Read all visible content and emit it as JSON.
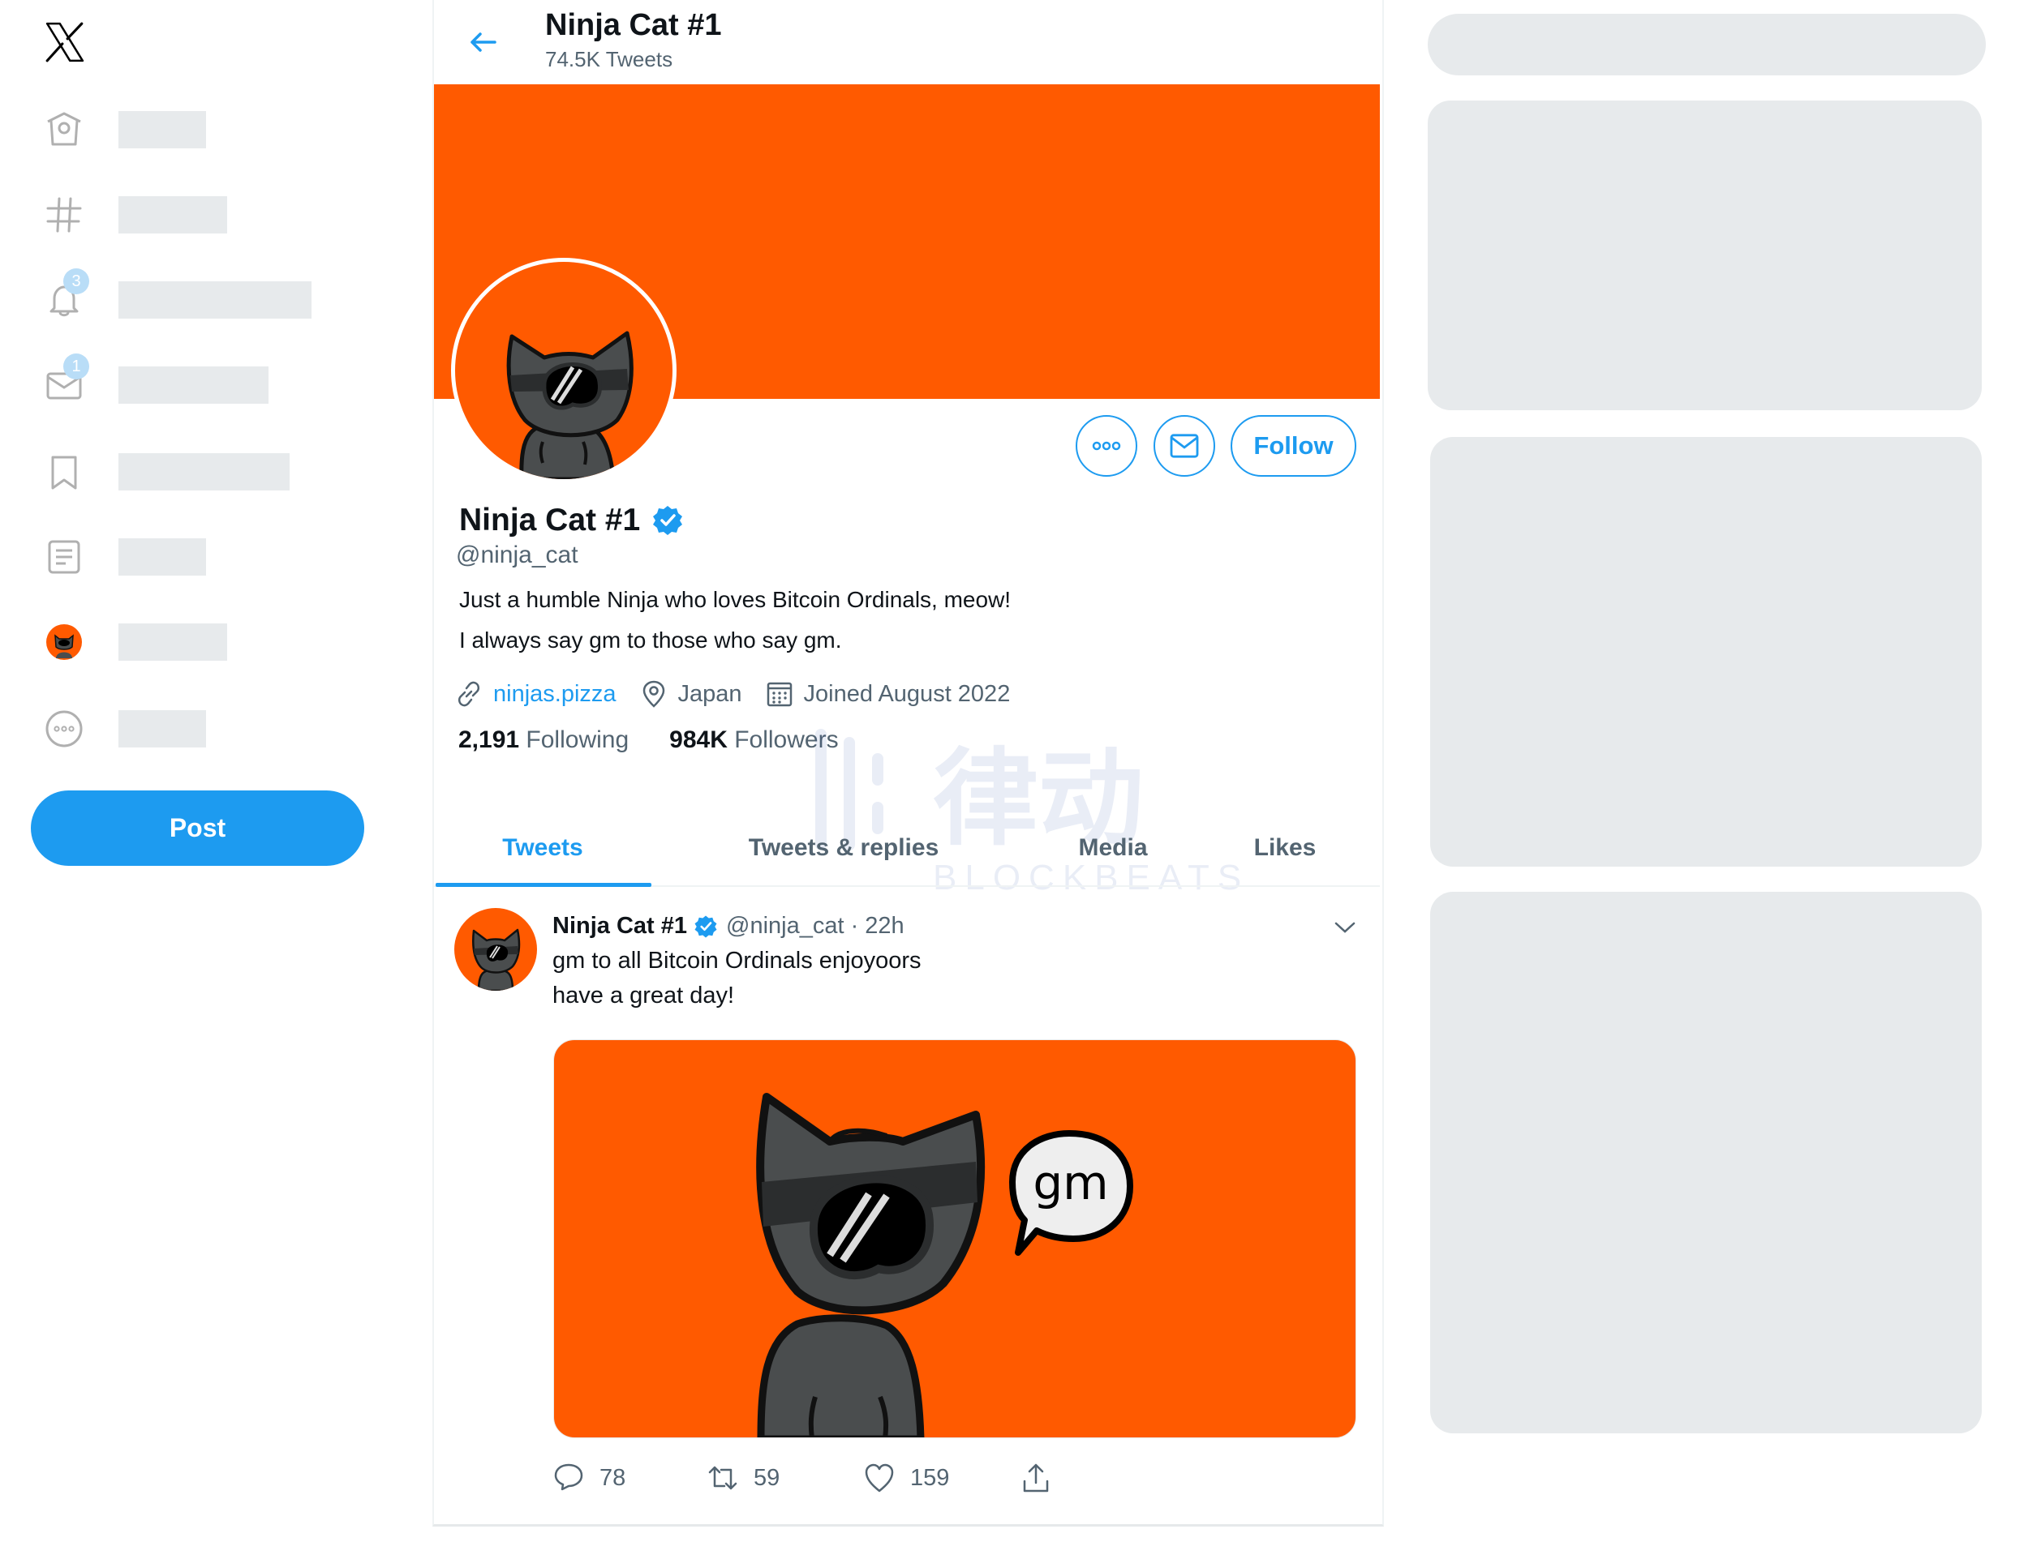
{
  "sidebar": {
    "logo": "x-logo",
    "items": [
      {
        "icon": "home-icon"
      },
      {
        "icon": "hashtag-icon"
      },
      {
        "icon": "bell-icon",
        "badge": "3"
      },
      {
        "icon": "mail-icon",
        "badge": "1"
      },
      {
        "icon": "bookmark-icon"
      },
      {
        "icon": "list-icon"
      },
      {
        "icon": "profile-avatar-icon"
      },
      {
        "icon": "more-circle-icon"
      }
    ],
    "post_label": "Post"
  },
  "header": {
    "title": "Ninja Cat #1",
    "subtitle": "74.5K Tweets"
  },
  "profile": {
    "name": "Ninja Cat #1",
    "verified": true,
    "handle": "@ninja_cat",
    "bio_lines": [
      "Just a humble Ninja who loves Bitcoin Ordinals, meow!",
      "I always say gm to those who say gm."
    ],
    "website": "ninjas.pizza",
    "location": "Japan",
    "joined": "Joined August 2022",
    "following_count": "2,191",
    "following_label": "Following",
    "followers_count": "984K",
    "followers_label": "Followers",
    "follow_label": "Follow"
  },
  "tabs": [
    {
      "label": "Tweets",
      "active": true
    },
    {
      "label": "Tweets & replies",
      "active": false
    },
    {
      "label": "Media",
      "active": false
    },
    {
      "label": "Likes",
      "active": false
    }
  ],
  "tweet": {
    "name": "Ninja Cat #1",
    "handle_time": "@ninja_cat · 22h",
    "lines": [
      "gm to all Bitcoin Ordinals enjoyoors",
      "have a great day!"
    ],
    "media_text": "gm",
    "replies": "78",
    "retweets": "59",
    "likes": "159"
  },
  "watermark": {
    "text": "律动",
    "sub": "BLOCKBEATS"
  },
  "colors": {
    "accent": "#1d9bf0",
    "brand_orange": "#ff5a00",
    "muted": "#536471",
    "skeleton": "#e7eaec"
  }
}
